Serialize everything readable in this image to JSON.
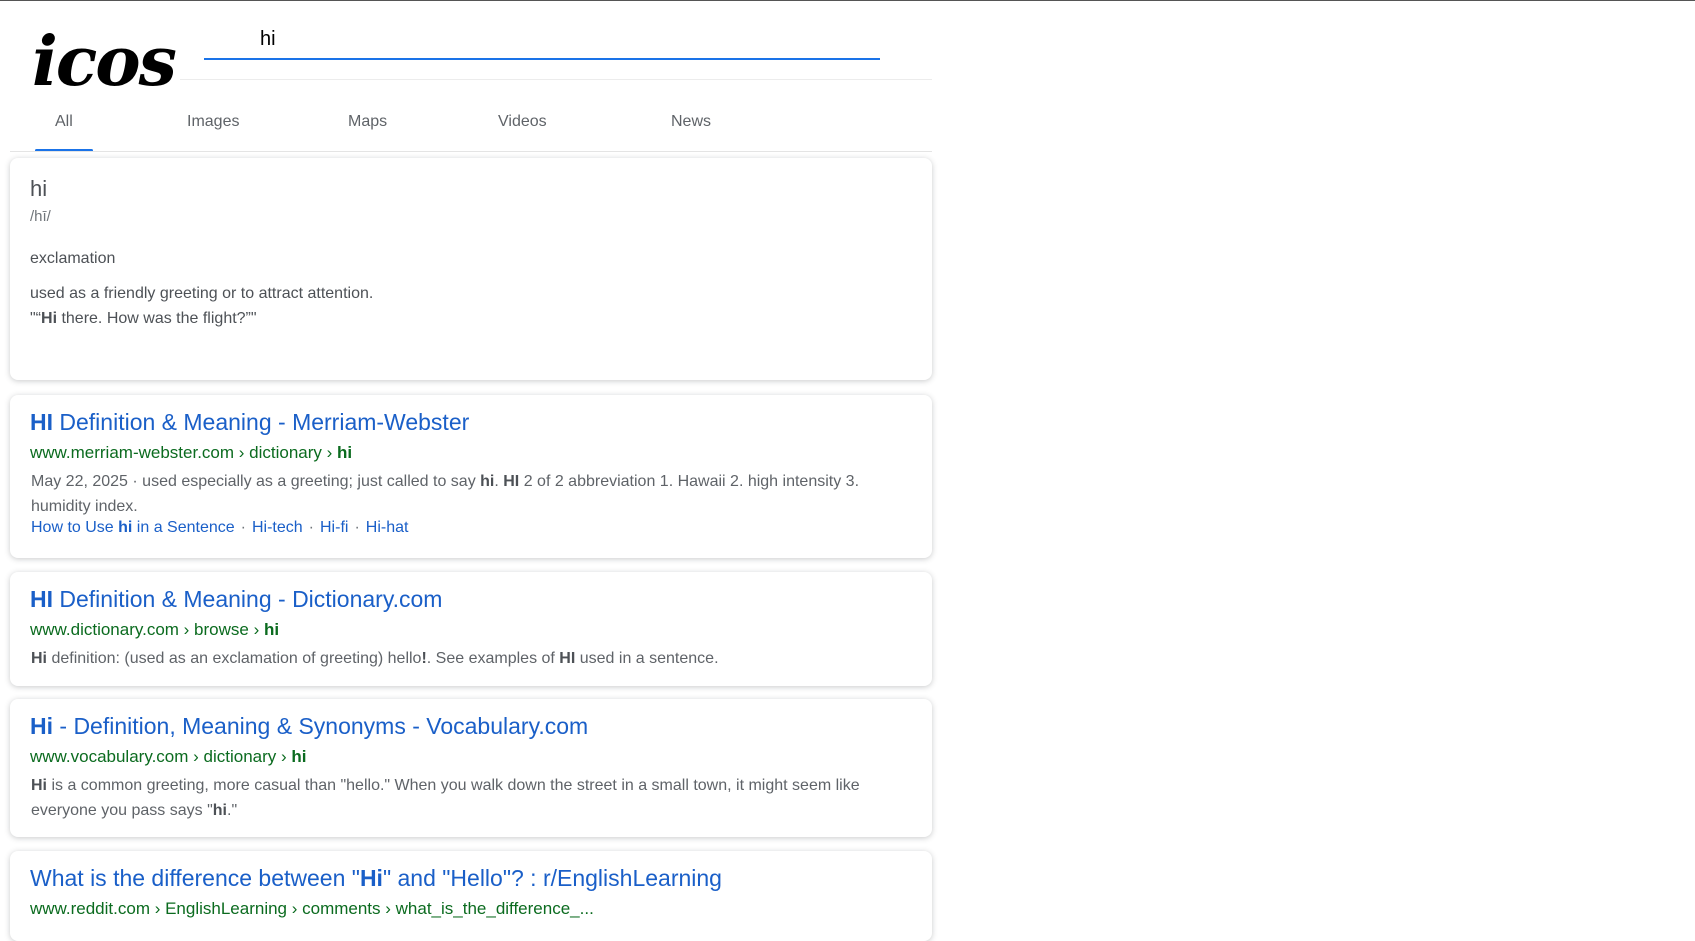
{
  "logo": {
    "text": "icos"
  },
  "search": {
    "value": "hi"
  },
  "tabs": [
    {
      "label": "All",
      "active": true
    },
    {
      "label": "Images"
    },
    {
      "label": "Maps"
    },
    {
      "label": "Videos"
    },
    {
      "label": "News"
    }
  ],
  "dictionary": {
    "word": "hi",
    "phonetic": "/hī/",
    "part_of_speech": "exclamation",
    "definition": "used as a friendly greeting or to attract attention.",
    "example_prefix": "\"“",
    "example_bold": "Hi",
    "example_rest": " there. How was the flight?”\""
  },
  "results": [
    {
      "title_bold": "HI",
      "title_rest": " Definition & Meaning - Merriam-Webster",
      "url_prefix": "www.merriam-webster.com › dictionary › ",
      "url_bold": "hi",
      "snippet": [
        {
          "t": "May 22, 2025 · used especially as a greeting; just called to say "
        },
        {
          "b": "hi"
        },
        {
          "t": ". "
        },
        {
          "b": "HI"
        },
        {
          "t": " 2 of 2 abbreviation 1. Hawaii 2. high intensity 3. humidity index."
        }
      ],
      "sitelinks": {
        "first_prefix": "How to Use ",
        "first_bold": "hi",
        "first_suffix": " in a Sentence",
        "second": "Hi-tech",
        "third": "Hi-fi",
        "fourth": "Hi-hat",
        "separator": "·"
      }
    },
    {
      "title_bold": "HI",
      "title_rest": " Definition & Meaning - Dictionary.com",
      "url_prefix": "www.dictionary.com › browse › ",
      "url_bold": "hi",
      "snippet": [
        {
          "b": "Hi"
        },
        {
          "t": " definition: (used as an exclamation of greeting) hello"
        },
        {
          "b": "!"
        },
        {
          "t": ". See examples of "
        },
        {
          "b": "HI"
        },
        {
          "t": " used in a sentence."
        }
      ]
    },
    {
      "title_bold": "Hi",
      "title_rest": " - Definition, Meaning & Synonyms - Vocabulary.com",
      "url_prefix": "www.vocabulary.com › dictionary › ",
      "url_bold": "hi",
      "snippet": [
        {
          "b": "Hi"
        },
        {
          "t": " is a common greeting, more casual than \"hello.\" When you walk down the street in a small town, it might seem like everyone you pass says \""
        },
        {
          "b": "hi"
        },
        {
          "t": ".\""
        }
      ]
    },
    {
      "title_pre": "What is the difference between \"",
      "title_bold": "Hi",
      "title_rest": "\" and \"Hello\"? : r/EnglishLearning",
      "url_prefix": "www.reddit.com › EnglishLearning › comments › what_is_the_difference_...",
      "url_bold": ""
    }
  ],
  "colors": {
    "link": "#1a5fc8",
    "url": "#0b6b1f",
    "tab_indicator": "#1a73e8"
  }
}
